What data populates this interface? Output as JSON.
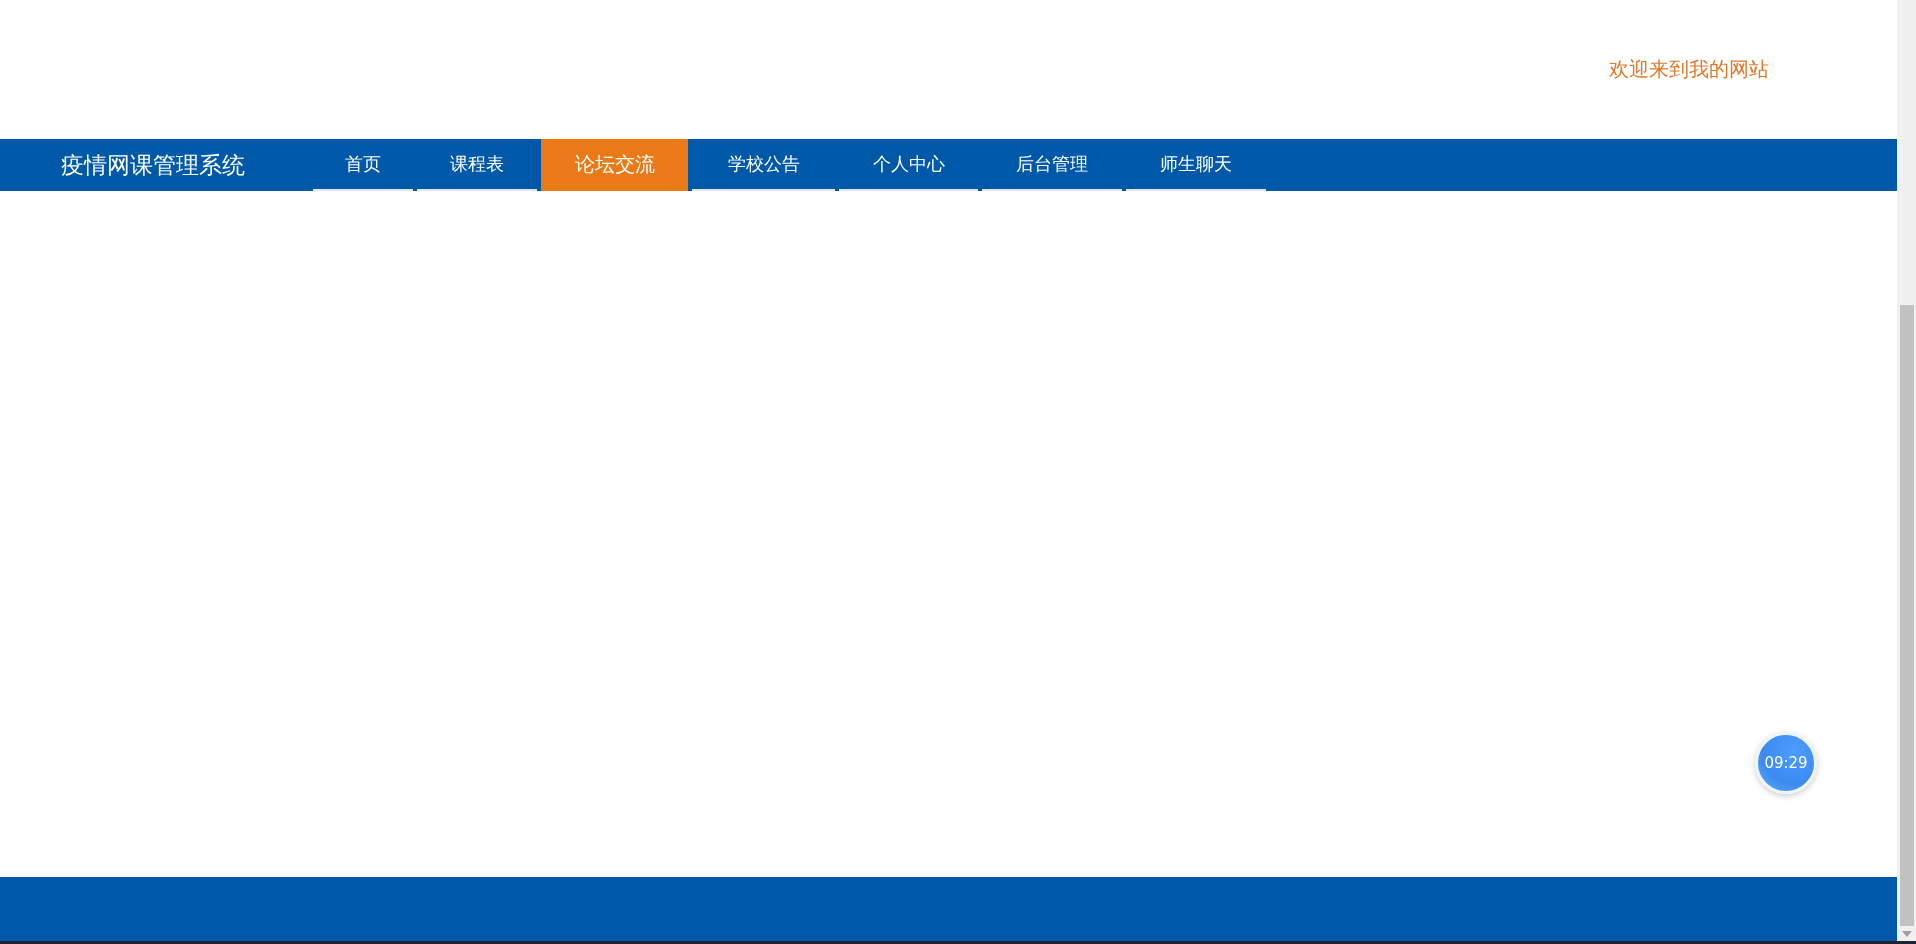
{
  "header": {
    "welcome": "欢迎来到我的网站"
  },
  "navbar": {
    "site_title": "疫情网课管理系统",
    "tabs": [
      {
        "label": "首页",
        "selected": false
      },
      {
        "label": "课程表",
        "selected": false
      },
      {
        "label": "论坛交流",
        "selected": true
      },
      {
        "label": "学校公告",
        "selected": false
      },
      {
        "label": "个人中心",
        "selected": false
      },
      {
        "label": "后台管理",
        "selected": false
      },
      {
        "label": "师生聊天",
        "selected": false
      }
    ]
  },
  "clock": {
    "time": "09:29"
  }
}
